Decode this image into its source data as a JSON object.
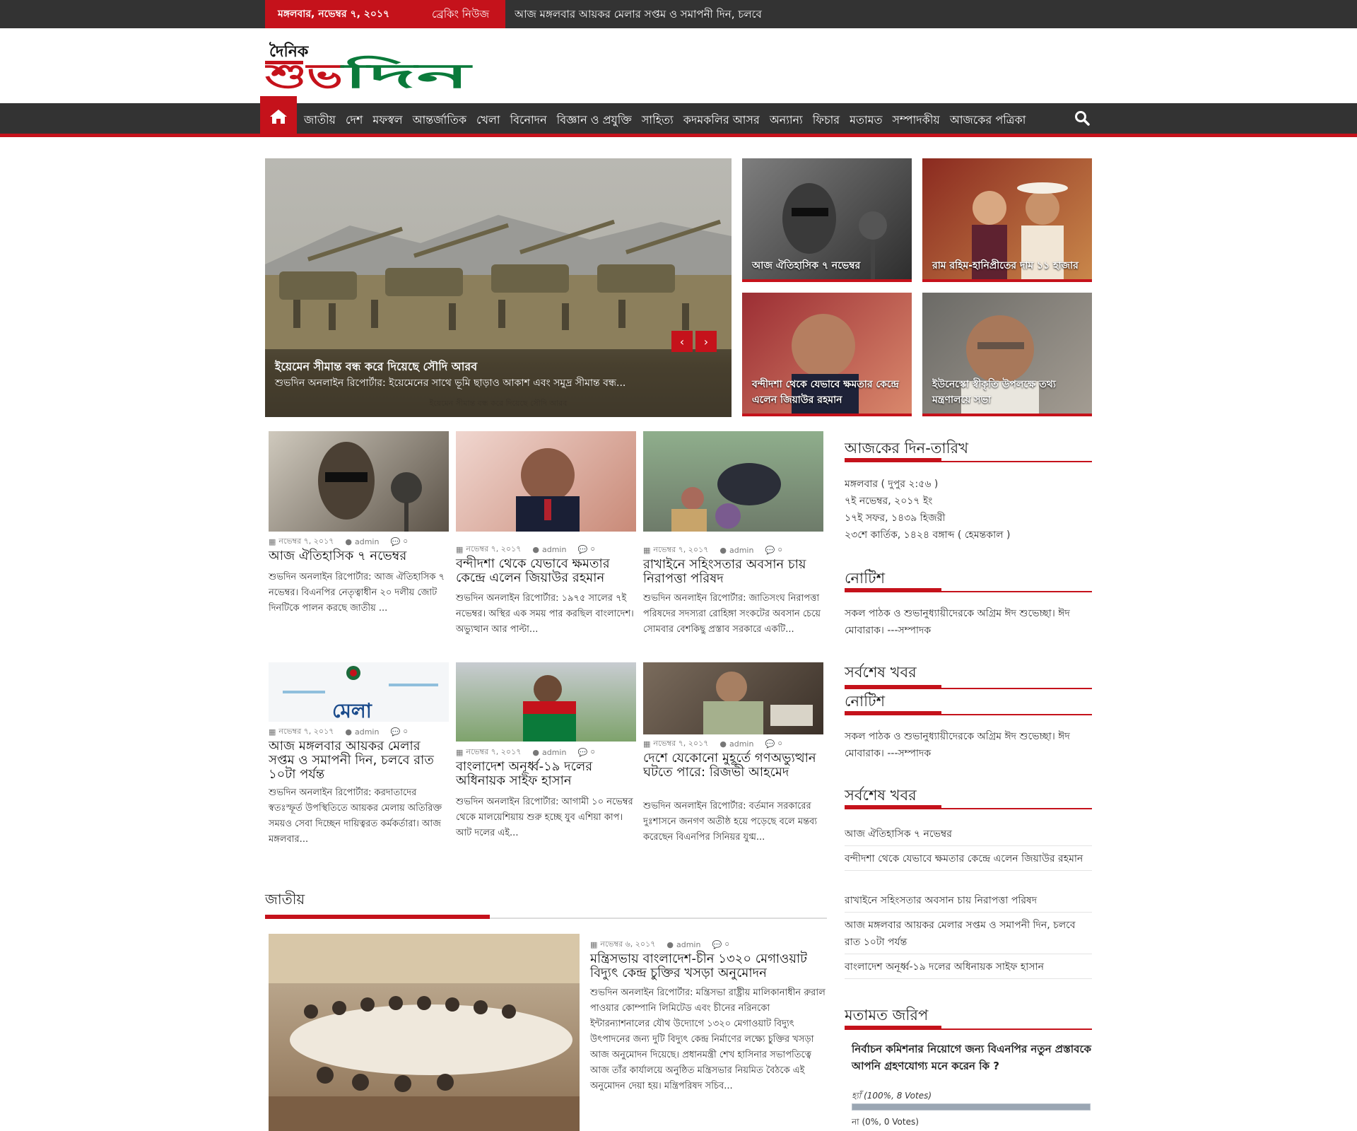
{
  "topbar": {
    "date": "মঙ্গলবার, নভেম্বর ৭, ২০১৭",
    "breaking_label": "ব্রেকিং নিউজ",
    "breaking_text": "আজ মঙ্গলবার আয়কর মেলার সপ্তম ও সমাপনী দিন, চলবে"
  },
  "logo": {
    "small": "দৈনিক",
    "big": "শুভদিন"
  },
  "nav": {
    "items": [
      "জাতীয়",
      "দেশ",
      "মফস্বল",
      "আন্তর্জাতিক",
      "খেলা",
      "বিনোদন",
      "বিজ্ঞান ও প্রযুক্তি",
      "সাহিত্য",
      "কদমকলির আসর",
      "অন্যান্য",
      "ফিচার",
      "মতামত",
      "সম্পাদকীয়",
      "আজকের পত্রিকা"
    ]
  },
  "slider": {
    "title": "ইয়েমেন সীমান্ত বন্ধ করে দিয়েছে সৌদি আরব",
    "excerpt": "শুভদিন অনলাইন রিপোর্টার: ইয়েমেনের সাথে ভূমি ছাড়াও আকাশ এবং সমুদ্র সীমান্ত বন্ধ...",
    "bottom_caption": "ইয়েমেন সীমান্ত বন্ধ করে দিয়েছে সৌদি আরব"
  },
  "tiles": [
    "আজ ঐতিহাসিক ৭ নভেম্বর",
    "রাম রহিম-হানিপ্রীতের দাম ১১ হাজার",
    "বন্দীদশা থেকে যেভাবে ক্ষমতার কেন্দ্রে এলেন জিয়াউর রহমান",
    "ইউনেস্কো স্বীকৃতি উপলক্ষে তথ্য মন্ত্রণালয়ে সভা"
  ],
  "cards": [
    {
      "date": "নভেম্বর ৭, ২০১৭",
      "author": "admin",
      "comments": "০",
      "title": "আজ ঐতিহাসিক ৭ নভেম্বর",
      "excerpt": "শুভদিন অনলাইন রিপোর্টার: আজ ঐতিহাসিক ৭ নভেম্বর। বিএনপির নেতৃত্বাধীন ২০ দলীয় জোট দিনটিকে পালন করছে জাতীয় ..."
    },
    {
      "date": "নভেম্বর ৭, ২০১৭",
      "author": "admin",
      "comments": "০",
      "title": "বন্দীদশা থেকে যেভাবে ক্ষমতার কেন্দ্রে এলেন জিয়াউর রহমান",
      "excerpt": "শুভদিন অনলাইন রিপোর্টার: ১৯৭৫ সালের ৭ই নভেম্বর। অস্থির এক সময় পার করছিল বাংলাদেশ। অভ্যুত্থান আর পাল্টা..."
    },
    {
      "date": "নভেম্বর ৭, ২০১৭",
      "author": "admin",
      "comments": "০",
      "title": "রাখাইনে সহিংসতার অবসান চায় নিরাপত্তা পরিষদ",
      "excerpt": "শুভদিন অনলাইন রিপোর্টার: জাতিসংঘ নিরাপত্তা পরিষদের সদস্যরা রোহিঙ্গা সংকটের অবসান চেয়ে সোমবার বেশকিছু প্রস্তাব সরকারে একটি..."
    },
    {
      "date": "নভেম্বর ৭, ২০১৭",
      "author": "admin",
      "comments": "০",
      "title": "আজ মঙ্গলবার আয়কর মেলার সপ্তম ও সমাপনী দিন, চলবে রাত ১০টা পর্যন্ত",
      "excerpt": "শুভদিন অনলাইন রিপোর্টার: করদাতাদের স্বতঃস্ফূর্ত উপস্থিতিতে আয়কর মেলায় অতিরিক্ত সময়ও সেবা দিচ্ছেন দায়িত্বরত কর্মকর্তারা। আজ মঙ্গলবার..."
    },
    {
      "date": "নভেম্বর ৭, ২০১৭",
      "author": "admin",
      "comments": "০",
      "title": "বাংলাদেশ অনূর্ধ্ব-১৯ দলের অধিনায়ক সাইফ হাসান",
      "excerpt": "শুভদিন অনলাইন রিপোর্টার: আগামী ১০ নভেম্বর থেকে মালয়েশিয়ায় শুরু হচ্ছে যুব এশিয়া কাপ। আট দলের এই..."
    },
    {
      "date": "নভেম্বর ৭, ২০১৭",
      "author": "admin",
      "comments": "০",
      "title": "দেশে যেকোনো মুহূর্তে গণঅভ্যুত্থান ঘটতে পারে: রিজভী আহমেদ",
      "excerpt": "শুভদিন অনলাইন রিপোর্টার: বর্তমান সরকারের দুঃশাসনে জনগণ অতীষ্ঠ হয়ে পড়েছে বলে মন্তব্য করেছেন বিএনপির সিনিয়র যুগ্ম..."
    }
  ],
  "jatiyo": {
    "heading": "জাতীয়",
    "date": "নভেম্বর ৬, ২০১৭",
    "author": "admin",
    "comments": "০",
    "title": "মন্ত্রিসভায় বাংলাদেশ-চীন ১৩২০ মেগাওয়াট বিদ্যুৎ কেন্দ্র চুক্তির খসড়া অনুমোদন",
    "excerpt": "শুভদিন অনলাইন রিপোর্টার: মন্ত্রিসভা রাষ্ট্রীয় মালিকানাধীন রুরাল পাওয়ার কোম্পানি লিমিটেড এবং চীনের নরিনকো ইন্টারন্যাশনালের যৌথ উদ্যোগে ১৩২০ মেগাওয়াট বিদ্যুৎ উৎপাদনের জন্য দুটি বিদ্যুৎ কেন্দ্র নির্মাণের লক্ষ্যে চুক্তির খসড়া আজ অনুমোদন দিয়েছে। প্রধানমন্ত্রী শেখ হাসিনার সভাপতিত্বে আজ তাঁর কার্যালয়ে অনুষ্ঠিত মন্ত্রিসভার নিয়মিত বৈঠকে এই অনুমোদন দেয়া হয়। মন্ত্রিপরিষদ সচিব..."
  },
  "sidebar": {
    "today_title": "আজকের দিন-তারিখ",
    "today_lines": [
      "মঙ্গলবার ( দুপুর ২:৫৬ )",
      "৭ই নভেম্বর, ২০১৭ ইং",
      "১৭ই সফর, ১৪৩৯ হিজরী",
      "২৩শে কার্তিক, ১৪২৪ বঙ্গাব্দ ( হেমন্তকাল )"
    ],
    "notice_title": "নোটিশ",
    "notice_text": "সকল পাঠক ও শুভানুধ্যায়ীদেরকে অগ্রিম ঈদ শুভেচ্ছা। ঈদ মোবারাক। ---সম্পাদক",
    "latest_title": "সর্বশেষ খবর",
    "notice_title_2": "নোটিশ",
    "notice_text_2": "সকল পাঠক ও শুভানুধ্যায়ীদেরকে অগ্রিম ঈদ শুভেচ্ছা। ঈদ মোবারাক। ---সম্পাদক",
    "latest_title_2": "সর্বশেষ খবর",
    "latest_links": [
      "আজ ঐতিহাসিক ৭ নভেম্বর",
      "বন্দীদশা থেকে যেভাবে ক্ষমতার কেন্দ্রে এলেন জিয়াউর রহমান",
      "রাখাইনে সহিংসতার অবসান চায় নিরাপত্তা পরিষদ",
      "আজ মঙ্গলবার আয়কর মেলার সপ্তম ও সমাপনী দিন, চলবে রাত ১০টা পর্যন্ত",
      "বাংলাদেশ অনূর্ধ্ব-১৯ দলের অধিনায়ক সাইফ হাসান"
    ],
    "poll_title": "মতামত জরিপ",
    "poll_question": "নির্বাচন কমিশনার নিয়োগে জন্য বিএনপির নতুন প্রস্তাবকে আপনি গ্রহণযোগ্য মনে করেন কি ?",
    "poll_yes_label": "হ্যাঁ",
    "poll_yes_stats": "(100%, 8 Votes)",
    "poll_yes_fraction": 1.0,
    "poll_no_label": "না",
    "poll_no_stats": "(0%, 0 Votes)",
    "poll_no_fraction": 0.0
  },
  "colors": {
    "accent": "#c5121b",
    "dark_bar": "#333333",
    "logo_green": "#0a7a3a"
  }
}
